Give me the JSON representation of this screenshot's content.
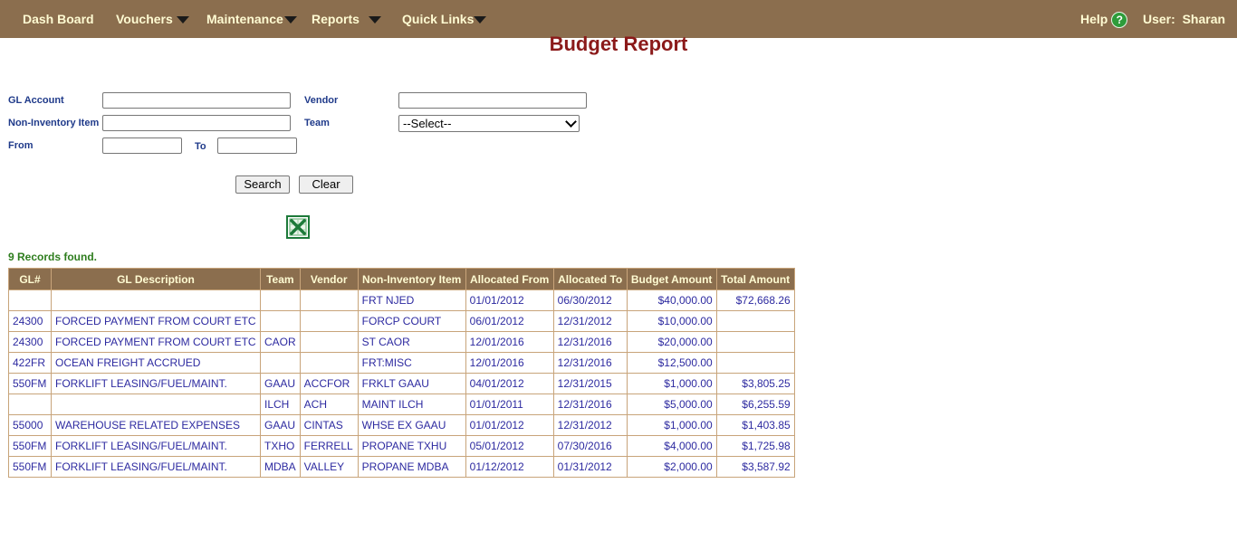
{
  "nav": {
    "dashboard": "Dash Board",
    "vouchers": "Vouchers",
    "maintenance": "Maintenance",
    "reports": "Reports",
    "quick_links": "Quick Links",
    "help": "Help",
    "user_label": "User:",
    "user_name": "Sharan"
  },
  "page_title": "Budget Report",
  "form": {
    "gl_account_label": "GL Account",
    "gl_account_value": "",
    "vendor_label": "Vendor",
    "vendor_value": "",
    "non_inventory_label": "Non-Inventory Item",
    "non_inventory_value": "",
    "team_label": "Team",
    "team_selected": "--Select--",
    "from_label": "From",
    "from_value": "",
    "to_label": "To",
    "to_value": "",
    "search_button": "Search",
    "clear_button": "Clear"
  },
  "icons": {
    "export": "excel-icon",
    "help": "question-circle-icon"
  },
  "colors": {
    "nav_bg": "#8b6e4e",
    "title": "#8b1a1a",
    "records": "#2e7d1e",
    "cell_text": "#2d2aa0"
  },
  "records_found": "9 Records found.",
  "table": {
    "headers": [
      "GL#",
      "GL Description",
      "Team",
      "Vendor",
      "Non-Inventory Item",
      "Allocated From",
      "Allocated To",
      "Budget Amount",
      "Total Amount"
    ],
    "rows": [
      [
        "",
        "",
        "",
        "",
        "FRT NJED",
        "01/01/2012",
        "06/30/2012",
        "$40,000.00",
        "$72,668.26"
      ],
      [
        "24300",
        "FORCED PAYMENT FROM COURT ETC",
        "",
        "",
        "FORCP COURT",
        "06/01/2012",
        "12/31/2012",
        "$10,000.00",
        ""
      ],
      [
        "24300",
        "FORCED PAYMENT FROM COURT ETC",
        "CAOR",
        "",
        "ST CAOR",
        "12/01/2016",
        "12/31/2016",
        "$20,000.00",
        ""
      ],
      [
        "422FR",
        "OCEAN FREIGHT ACCRUED",
        "",
        "",
        "FRT:MISC",
        "12/01/2016",
        "12/31/2016",
        "$12,500.00",
        ""
      ],
      [
        "550FM",
        "FORKLIFT LEASING/FUEL/MAINT.",
        "GAAU",
        "ACCFOR",
        "FRKLT GAAU",
        "04/01/2012",
        "12/31/2015",
        "$1,000.00",
        "$3,805.25"
      ],
      [
        "",
        "",
        "ILCH",
        "ACH",
        "MAINT ILCH",
        "01/01/2011",
        "12/31/2016",
        "$5,000.00",
        "$6,255.59"
      ],
      [
        "55000",
        "WAREHOUSE RELATED EXPENSES",
        "GAAU",
        "CINTAS",
        "WHSE EX GAAU",
        "01/01/2012",
        "12/31/2012",
        "$1,000.00",
        "$1,403.85"
      ],
      [
        "550FM",
        "FORKLIFT LEASING/FUEL/MAINT.",
        "TXHO",
        "FERRELL",
        "PROPANE TXHU",
        "05/01/2012",
        "07/30/2016",
        "$4,000.00",
        "$1,725.98"
      ],
      [
        "550FM",
        "FORKLIFT LEASING/FUEL/MAINT.",
        "MDBA",
        "VALLEY",
        "PROPANE MDBA",
        "01/12/2012",
        "01/31/2012",
        "$2,000.00",
        "$3,587.92"
      ]
    ]
  }
}
